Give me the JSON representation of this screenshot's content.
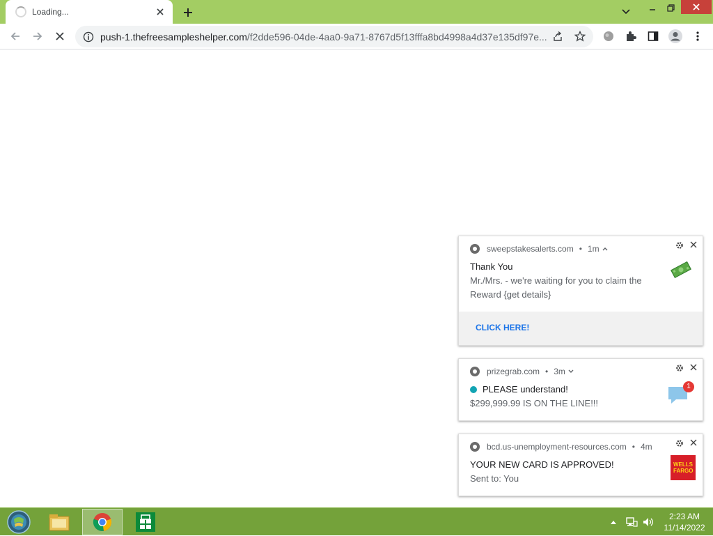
{
  "browser": {
    "tab_title": "Loading...",
    "url_host": "push-1.thefreesampleshelper.com",
    "url_rest": "/f2dde596-04de-4aa0-9a71-8767d5f13fffa8bd4998a4d37e135df97e..."
  },
  "notifications": [
    {
      "site": "sweepstakesalerts.com",
      "time": "1m",
      "title": "Thank You",
      "body": "Mr./Mrs.  - we're waiting for you to claim the Reward {get details}",
      "action": "CLICK HERE!",
      "icon": "cash-icon"
    },
    {
      "site": "prizegrab.com",
      "time": "3m",
      "title": "PLEASE understand!",
      "body": "$299,999.99 IS ON THE LINE!!!",
      "icon": "chat-bubble-icon",
      "badge": "1"
    },
    {
      "site": "bcd.us-unemployment-resources.com",
      "time": "4m",
      "title": "YOUR NEW CARD IS APPROVED!",
      "body": "Sent to: You",
      "icon": "wells-fargo-logo",
      "logo_text": "WELLS FARGO"
    }
  ],
  "taskbar": {
    "time": "2:23 AM",
    "date": "11/14/2022"
  },
  "colors": {
    "frame": "#a3cd63",
    "taskbar": "#74a23a",
    "close": "#c7413a",
    "link": "#1a73e8"
  }
}
